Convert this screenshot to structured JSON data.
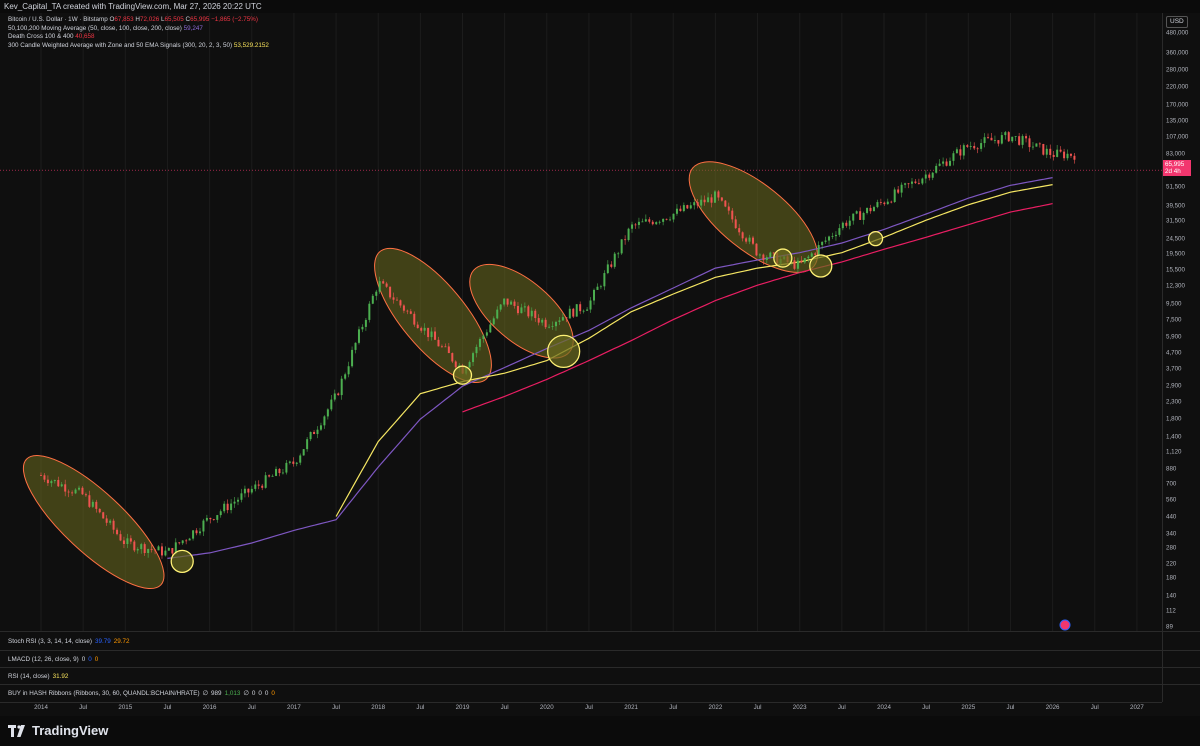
{
  "header": {
    "credit": "Kev_Capital_TA created with TradingView.com, Mar 27, 2026 20:22 UTC"
  },
  "legend": {
    "symbol": "Bitcoin / U.S. Dollar · 1W · Bitstamp",
    "open_label": "O",
    "open": "67,853",
    "high_label": "H",
    "high": "72,026",
    "low_label": "L",
    "low": "65,505",
    "close_label": "C",
    "close": "65,995",
    "change": "−1,865 (−2.75%)",
    "ma_label": "50,100,200 Moving Average (50, close, 100, close, 200, close)",
    "ma_value": "59,247",
    "dc_label": "Death Cross 100 & 400",
    "dc_value": "40,658",
    "cwa_label": "300 Candle Weighted Average with Zone and 50 EMA Signals (300, 20, 2, 3, 50)",
    "cwa_value": "53,529.2152"
  },
  "axis": {
    "currency": "USD",
    "ticks": [
      "480,000",
      "360,000",
      "280,000",
      "220,000",
      "170,000",
      "135,000",
      "107,000",
      "83,000",
      "51,500",
      "39,500",
      "31,500",
      "24,500",
      "19,500",
      "15,500",
      "12,300",
      "9,500",
      "7,500",
      "5,900",
      "4,700",
      "3,700",
      "2,900",
      "2,300",
      "1,800",
      "1,400",
      "1,120",
      "880",
      "700",
      "560",
      "440",
      "340",
      "280",
      "220",
      "180",
      "140",
      "112",
      "89"
    ],
    "price_tag_value": "65,995",
    "price_tag_time": "2d 4h"
  },
  "indicators": {
    "stoch_label": "Stoch RSI (3, 3, 14, 14, close)",
    "stoch_k": "39.79",
    "stoch_d": "29.72",
    "lmacd_label": "LMACD (12, 26, close, 9)",
    "lmacd_v1": "0",
    "lmacd_v2": "0",
    "lmacd_v3": "0",
    "rsi_label": "RSI (14, close)",
    "rsi_value": "31.92",
    "hash_label": "BUY in HASH Ribbons (Ribbons, 30, 60, QUANDL:BCHAIN/HRATE)",
    "hash_empty": "∅",
    "hash_v1": "989",
    "hash_v2": "1,013",
    "hash_v3": "0",
    "hash_v4": "0",
    "hash_v5": "0",
    "hash_v6": "0"
  },
  "xaxis": {
    "ticks": [
      "2014",
      "Jul",
      "2015",
      "Jul",
      "2016",
      "Jul",
      "2017",
      "Jul",
      "2018",
      "Jul",
      "2019",
      "Jul",
      "2020",
      "Jul",
      "2021",
      "Jul",
      "2022",
      "Jul",
      "2023",
      "Jul",
      "2024",
      "Jul",
      "2025",
      "Jul",
      "2026",
      "Jul",
      "2027"
    ]
  },
  "footer": {
    "brand": "TradingView"
  },
  "colors": {
    "up": "#26a69a",
    "up_bright": "#4caf50",
    "down": "#ef5350",
    "ma_purple": "#7e57c2",
    "cwa_yellow": "#f5e663",
    "dc_red": "#e91e63",
    "zone_fill": "#6b6b1f",
    "zone_stroke": "#ff7043",
    "circle_stroke": "#fff176",
    "price_tag": "#f2366e"
  },
  "chart_data": {
    "type": "line",
    "title": "Bitcoin / U.S. Dollar · 1W · Bitstamp",
    "y_scale": "log",
    "ylim": [
      89,
      480000
    ],
    "x": [
      "2014",
      "Jul",
      "2015",
      "Jul",
      "2016",
      "Jul",
      "2017",
      "Jul",
      "2018",
      "Jul",
      "2019",
      "Jul",
      "2020",
      "Jul",
      "2021",
      "Jul",
      "2022",
      "Jul",
      "2023",
      "Jul",
      "2024",
      "Jul",
      "2025",
      "Jul",
      "2026"
    ],
    "series": [
      {
        "name": "Bitcoin / U.S. Dollar",
        "values": [
          800,
          600,
          300,
          260,
          430,
          650,
          960,
          2500,
          13000,
          7000,
          3700,
          10000,
          7200,
          9500,
          29000,
          35000,
          45000,
          20000,
          16500,
          30000,
          42000,
          62000,
          94000,
          108000,
          83000
        ]
      },
      {
        "name": "50,100,200 Moving Average",
        "values": [
          null,
          null,
          null,
          240,
          260,
          300,
          360,
          420,
          900,
          1800,
          2900,
          3800,
          5000,
          6500,
          9000,
          12000,
          16000,
          18000,
          20000,
          23000,
          28000,
          35000,
          44000,
          53000,
          59247
        ]
      },
      {
        "name": "300 Candle Weighted Average with Zone and 50 EMA Signals",
        "values": [
          null,
          null,
          null,
          null,
          null,
          null,
          null,
          440,
          1300,
          2600,
          3100,
          3500,
          4200,
          5800,
          8500,
          11000,
          14000,
          16000,
          17500,
          20000,
          25000,
          32000,
          40000,
          48000,
          53529
        ]
      },
      {
        "name": "Death Cross 100 & 400",
        "values": [
          null,
          null,
          null,
          null,
          null,
          null,
          null,
          null,
          null,
          null,
          2000,
          2500,
          3200,
          4200,
          5600,
          7600,
          10000,
          12500,
          15000,
          17500,
          21000,
          25000,
          30000,
          36000,
          40658
        ]
      }
    ]
  }
}
